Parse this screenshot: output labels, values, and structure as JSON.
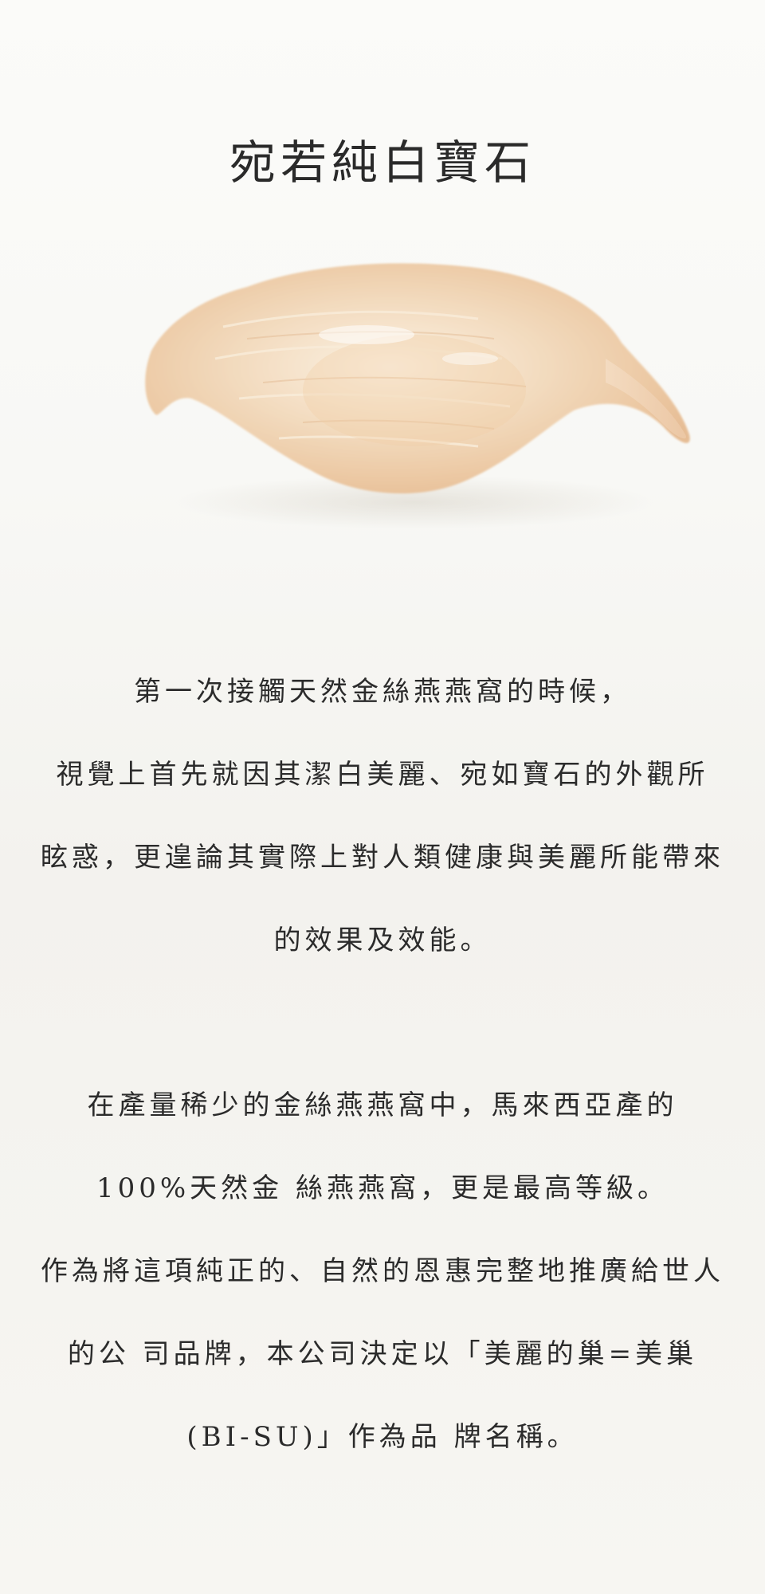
{
  "title": "宛若純白寶石",
  "image": {
    "subject": "bird-nest-icon"
  },
  "paragraph1": {
    "lines": [
      "第一次接觸天然金絲燕燕窩的時候，",
      "視覺上首先就因其潔白美麗、宛如寶石的外觀所",
      "眩惑，更遑論其實際上對人類健康與美麗所能帶來",
      "的效果及效能。"
    ]
  },
  "paragraph2": {
    "lines": [
      "在產量稀少的金絲燕燕窩中，馬來西亞產的",
      "100%天然金 絲燕燕窩，更是最高等級。",
      "作為將這項純正的、自然的恩惠完整地推廣給世人",
      "的公 司品牌，本公司決定以「美麗的巢=美巢",
      "(BI-SU)」作為品 牌名稱。"
    ]
  },
  "colors": {
    "text": "#2b2b2b",
    "nest_light": "#f6e8d6",
    "nest_mid": "#efd3b4",
    "nest_deep": "#e7bf98"
  }
}
